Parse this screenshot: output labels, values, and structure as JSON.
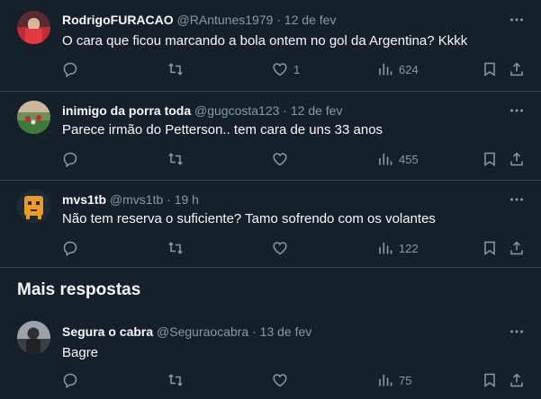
{
  "tweets": [
    {
      "name": "RodrigoFURACAO",
      "handle": "@RAntunes1979",
      "dot": "·",
      "time": "12 de fev",
      "text": "O cara que ficou marcando a bola ontem no gol da Argentina? Kkkk",
      "likes": "1",
      "views": "624"
    },
    {
      "name": "inimigo da porra toda",
      "handle": "@gugcosta123",
      "dot": "·",
      "time": "12 de fev",
      "text": "Parece irmão do Petterson.. tem cara de uns 33 anos",
      "likes": "",
      "views": "455"
    },
    {
      "name": "mvs1tb",
      "handle": "@mvs1tb",
      "dot": "·",
      "time": "19 h",
      "text": "Não tem reserva o suficiente? Tamo sofrendo com os volantes",
      "likes": "",
      "views": "122"
    },
    {
      "name": "Segura o cabra",
      "handle": "@Seguraocabra",
      "dot": "·",
      "time": "13 de fev",
      "text": "Bagre",
      "likes": "",
      "views": "75"
    }
  ],
  "section": {
    "title": "Mais respostas"
  },
  "icons": {
    "reply": "reply-icon",
    "retweet": "retweet-icon",
    "like": "heart-icon",
    "views": "views-icon",
    "bookmark": "bookmark-icon",
    "share": "share-icon",
    "more": "more-icon"
  },
  "colors": {
    "background": "#15202b",
    "text": "#f7f9f9",
    "secondary": "#8b98a5",
    "divider": "#38444d"
  }
}
